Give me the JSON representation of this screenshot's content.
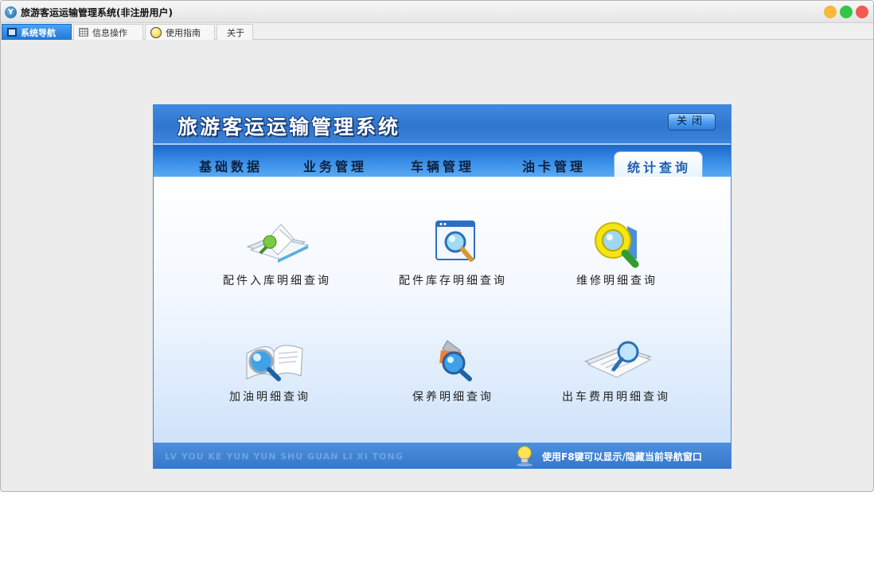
{
  "window": {
    "title": "旅游客运运输管理系统(非注册用户)",
    "app_icon_glyph": "Y"
  },
  "tabs": [
    {
      "label": "系统导航",
      "icon": "monitor-icon",
      "active": true
    },
    {
      "label": "信息操作",
      "icon": "grid-icon",
      "active": false
    },
    {
      "label": "使用指南",
      "icon": "bulb-icon",
      "active": false
    },
    {
      "label": "关于",
      "icon": "",
      "active": false
    }
  ],
  "panel": {
    "system_title": "旅游客运运输管理系统",
    "close_label": "关闭",
    "nav_tabs": [
      {
        "label": "基础数据",
        "active": false
      },
      {
        "label": "业务管理",
        "active": false
      },
      {
        "label": "车辆管理",
        "active": false
      },
      {
        "label": "油卡管理",
        "active": false
      },
      {
        "label": "统计查询",
        "active": true
      }
    ],
    "items": [
      {
        "label": "配件入库明细查询",
        "icon": "parts-inbound-search-icon"
      },
      {
        "label": "配件库存明细查询",
        "icon": "parts-stock-search-icon"
      },
      {
        "label": "维修明细查询",
        "icon": "repair-search-icon"
      },
      {
        "label": "加油明细查询",
        "icon": "refuel-search-icon"
      },
      {
        "label": "保养明细查询",
        "icon": "maintenance-search-icon"
      },
      {
        "label": "出车费用明细查询",
        "icon": "trip-cost-search-icon"
      }
    ],
    "footer": {
      "pinyin": "LV YOU KE YUN YUN SHU GUAN LI XI TONG",
      "hint": "使用F8键可以显示/隐藏当前导航窗口"
    }
  },
  "colors": {
    "header_blue": "#2f76cf",
    "nav_blue": "#3d93ea",
    "active_tab_blue": "#1f78d8",
    "footer_blue": "#3576c9"
  }
}
